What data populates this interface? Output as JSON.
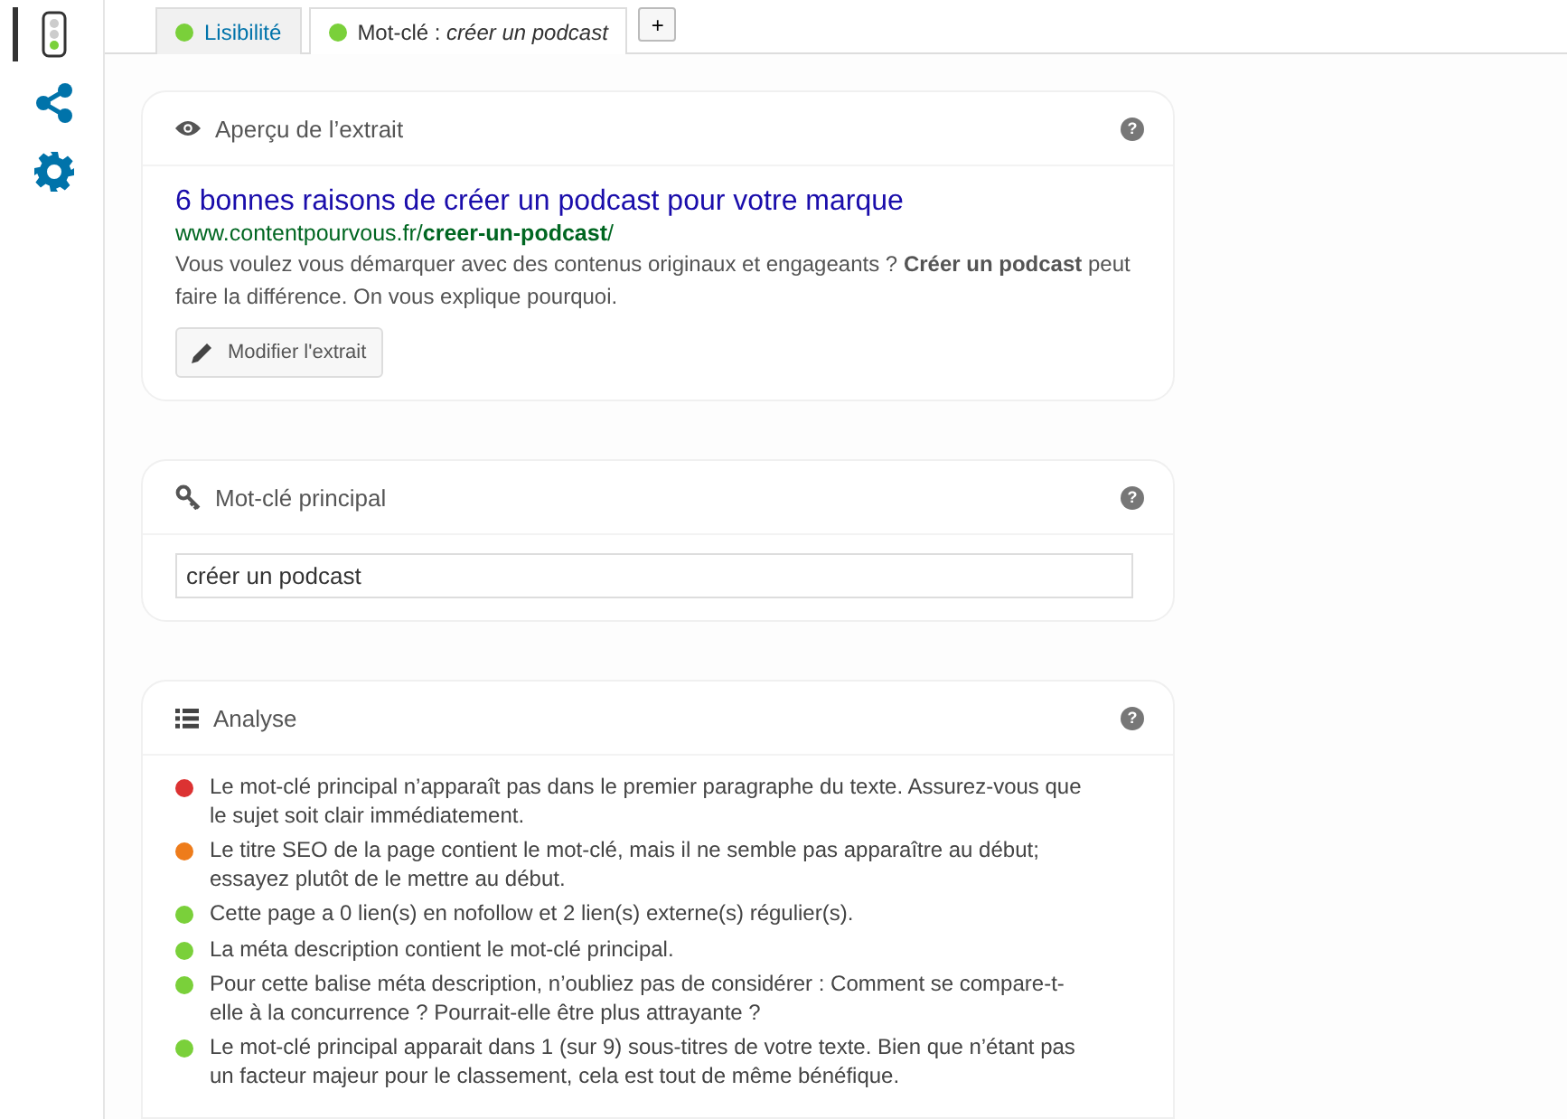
{
  "sidebar": {
    "items": [
      {
        "kind": "traffic-light",
        "selected": true
      },
      {
        "kind": "share",
        "selected": false
      },
      {
        "kind": "gear",
        "selected": false
      }
    ]
  },
  "tabs": [
    {
      "label": "Lisibilité",
      "selected": false,
      "color": "#7ad03a"
    },
    {
      "label": "Mot-clé : *créer un podcast*",
      "selected": true,
      "color": "#7ad03a"
    }
  ],
  "add_tab": "+",
  "snippet": {
    "title": "Aperçu de l’extrait",
    "help": "?",
    "headline": "6 bonnes raisons de créer un podcast pour votre marque",
    "url": "www.contentpourvous.fr/**creer-un-podcast**/",
    "description": "Vous voulez vous démarquer avec des contenus originaux et engageants ? **Créer un podcast** peut faire la différence. On vous explique pourquoi.",
    "edit_button": "Modifier l'extrait"
  },
  "keyword": {
    "title": "Mot-clé principal",
    "help": "?",
    "value": "créer un podcast"
  },
  "analysis": {
    "title": "Analyse",
    "help": "?",
    "items": [
      {
        "color": "#dc3232",
        "text": "Le mot-clé principal n’apparaît pas dans le premier paragraphe du texte. Assurez-vous que le sujet soit clair immédiatement."
      },
      {
        "color": "#ee7c1b",
        "text": "Le titre SEO de la page contient le mot-clé, mais il ne semble pas apparaître au début; essayez plutôt de le mettre au début."
      },
      {
        "color": "#7ad03a",
        "text": "Cette page a 0 lien(s) en nofollow et 2 lien(s) externe(s) régulier(s)."
      },
      {
        "color": "#7ad03a",
        "text": "La méta description contient le mot-clé principal."
      },
      {
        "color": "#7ad03a",
        "text": "Pour cette balise méta description, n’oubliez pas de considérer : Comment se compare-t-elle à la concurrence ? Pourrait-elle être plus attrayante ?"
      },
      {
        "color": "#7ad03a",
        "text": "Le mot-clé principal apparait dans 1 (sur 9) sous-titres de votre texte. Bien que n’étant pas un facteur majeur pour le classement, cela est tout de même bénéfique."
      }
    ]
  }
}
